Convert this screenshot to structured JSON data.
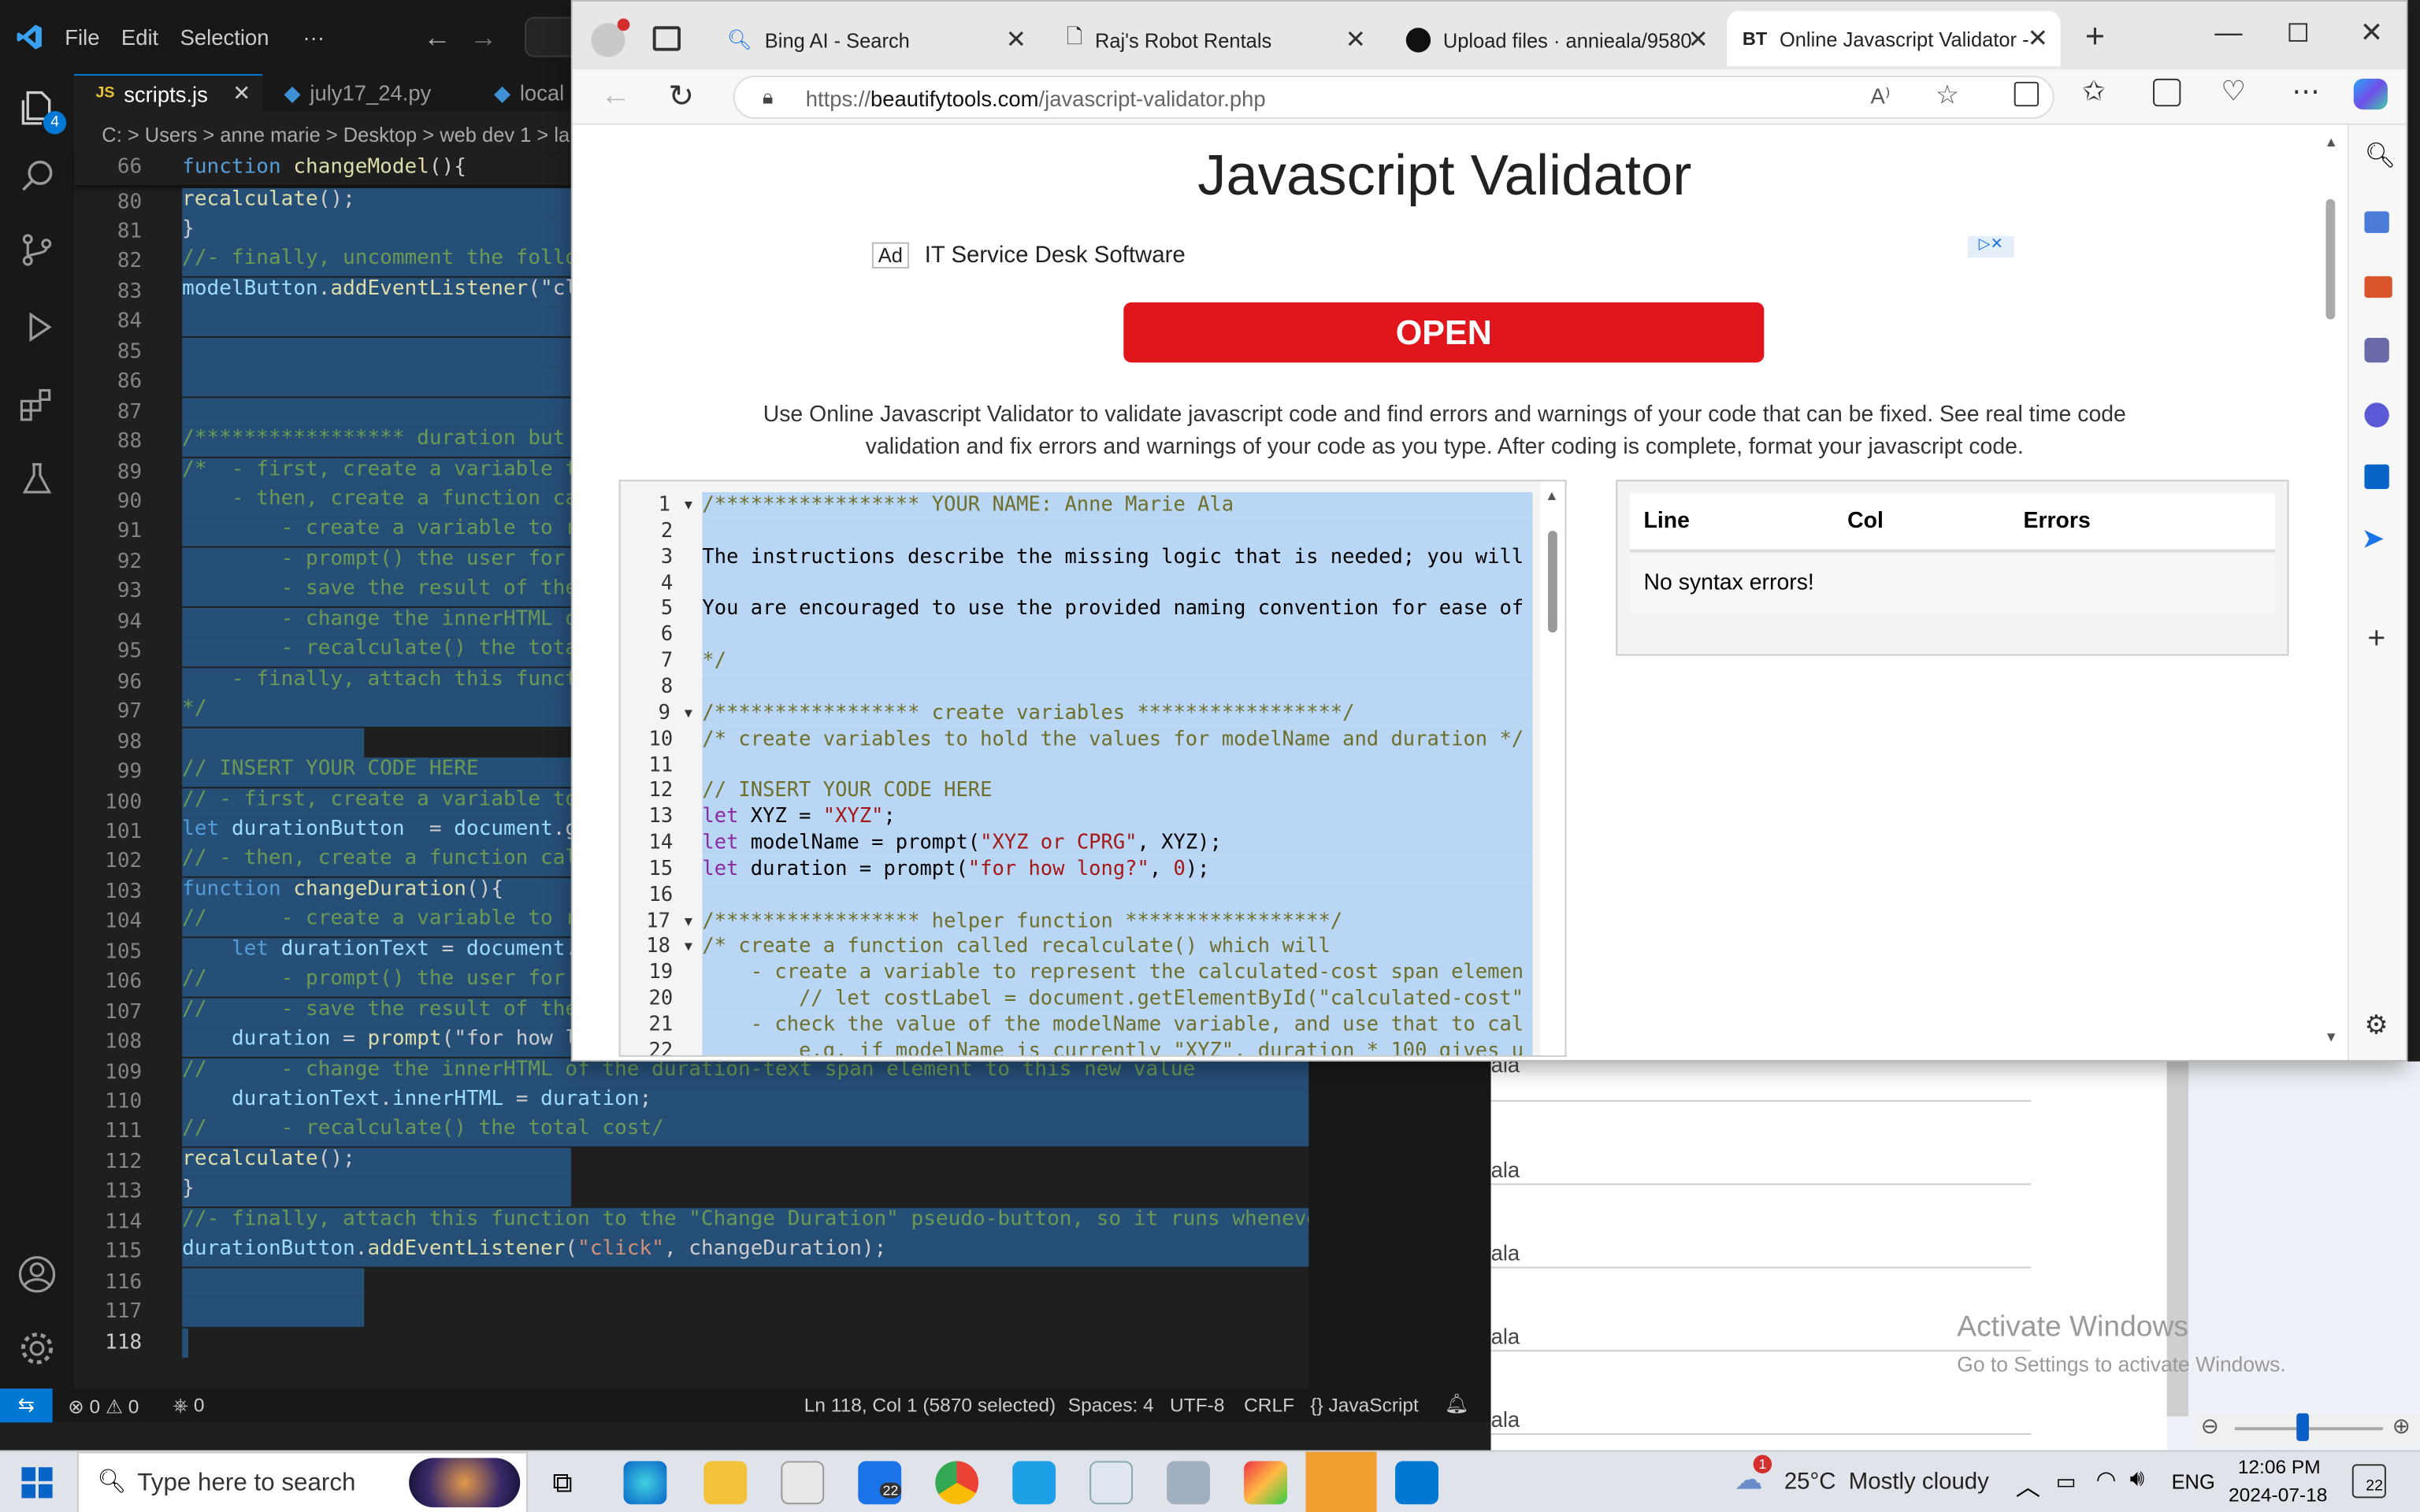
{
  "vscode": {
    "menu": [
      "File",
      "Edit",
      "Selection",
      "···"
    ],
    "tabs": [
      {
        "label": "scripts.js",
        "lang": "JS",
        "active": true
      },
      {
        "label": "july17_24.py",
        "lang": "py",
        "active": false
      },
      {
        "label": "local",
        "lang": "py",
        "active": false
      }
    ],
    "breadcrumb": "C: > Users > anne marie > Desktop > web dev 1 > la",
    "badge": "4",
    "sticky_line_no": "66",
    "sticky_line": "function changeModel(){",
    "line_numbers": [
      "80",
      "81",
      "82",
      "83",
      "84",
      "85",
      "86",
      "87",
      "88",
      "89",
      "90",
      "91",
      "92",
      "93",
      "94",
      "95",
      "96",
      "97",
      "98",
      "99",
      "100",
      "101",
      "102",
      "103",
      "104",
      "105",
      "106",
      "107",
      "108",
      "109",
      "110",
      "111",
      "112",
      "113",
      "114",
      "115",
      "116",
      "117",
      "118"
    ],
    "code": [
      "recalculate();",
      "}",
      "//- finally, uncomment the follo",
      "modelButton.addEventListener(\"cli",
      "",
      "",
      "",
      "",
      "/***************** duration but",
      "/*  - first, create a variable t",
      "    - then, create a function ca",
      "        - create a variable to r",
      "        - prompt() the user for",
      "        - save the result of the",
      "        - change the innerHTML o",
      "        - recalculate() the tota",
      "    - finally, attach this funct",
      "*/",
      "",
      "// INSERT YOUR CODE HERE",
      "// - first, create a variable to",
      "let durationButton  = document.g",
      "// - then, create a function cal",
      "function changeDuration(){",
      "//      - create a variable to r",
      "    let durationText = document.",
      "//      - prompt() the user for",
      "//      - save the result of the",
      "    duration = prompt(\"for how l",
      "//      - change the innerHTML of the duration-text span element to this new value",
      "    durationText.innerHTML = duration;",
      "//      - recalculate() the total cost/",
      "recalculate();",
      "}",
      "//- finally, attach this function to the \"Change Duration\" pseudo-button, so it runs whenever",
      "durationButton.addEventListener(\"click\", changeDuration);",
      "",
      "",
      ""
    ],
    "status": {
      "errors": "0",
      "warnings": "0",
      "ports": "0",
      "position": "Ln 118, Col 1 (5870 selected)",
      "spaces": "Spaces: 4",
      "encoding": "UTF-8",
      "eol": "CRLF",
      "language": "JavaScript"
    }
  },
  "browser": {
    "tabs": [
      {
        "label": "Bing AI - Search"
      },
      {
        "label": "Raj's Robot Rentals"
      },
      {
        "label": "Upload files · annieala/9580"
      },
      {
        "label": "Online Javascript Validator -",
        "active": true
      }
    ],
    "url_prefix": "https://",
    "url_domain": "beautifytools.com",
    "url_path": "/javascript-validator.php",
    "page": {
      "title": "Javascript Validator",
      "ad_tag": "Ad",
      "ad_text": "IT Service Desk Software",
      "open_button": "OPEN",
      "description": "Use Online Javascript Validator to validate javascript code and find errors and warnings of your code that can be fixed. See real time code validation and fix errors and warnings of your code as you type. After coding is complete, format your javascript code.",
      "results_headers": [
        "Line",
        "Col",
        "Errors"
      ],
      "results_message": "No syntax errors!",
      "editor_line_numbers": [
        "1",
        "2",
        "3",
        "4",
        "5",
        "6",
        "7",
        "8",
        "9",
        "10",
        "11",
        "12",
        "13",
        "14",
        "15",
        "16",
        "17",
        "18",
        "19",
        "20",
        "21",
        "22"
      ],
      "editor_lines": [
        "/***************** YOUR NAME: Anne Marie Ala",
        "",
        "The instructions describe the missing logic that is needed; you will",
        "",
        "You are encouraged to use the provided naming convention for ease of",
        "",
        "*/",
        "",
        "/***************** create variables *****************/",
        "/* create variables to hold the values for modelName and duration */",
        "",
        "// INSERT YOUR CODE HERE",
        "let XYZ = \"XYZ\";",
        "let modelName = prompt(\"XYZ or CPRG\", XYZ);",
        "let duration = prompt(\"for how long?\", 0);",
        "",
        "/***************** helper function *****************/",
        "/* create a function called recalculate() which will",
        "    - create a variable to represent the calculated-cost span elemen",
        "        // let costLabel = document.getElementById(\"calculated-cost\"",
        "    - check the value of the modelName variable, and use that to cal",
        "        e.g. if modelName is currently \"XYZ\", duration * 100 gives u"
      ]
    }
  },
  "background_window": {
    "list_items": [
      "ala",
      "ala",
      "ala",
      "ala",
      "ala"
    ],
    "watermark_title": "Activate Windows",
    "watermark_sub": "Go to Settings to activate Windows."
  },
  "taskbar": {
    "search_placeholder": "Type here to search",
    "mail_badge": "22",
    "weather": "25°C  Mostly cloudy",
    "weather_badge": "1",
    "lang": "ENG",
    "time": "12:06 PM",
    "date": "2024-07-18",
    "notif": "22"
  }
}
